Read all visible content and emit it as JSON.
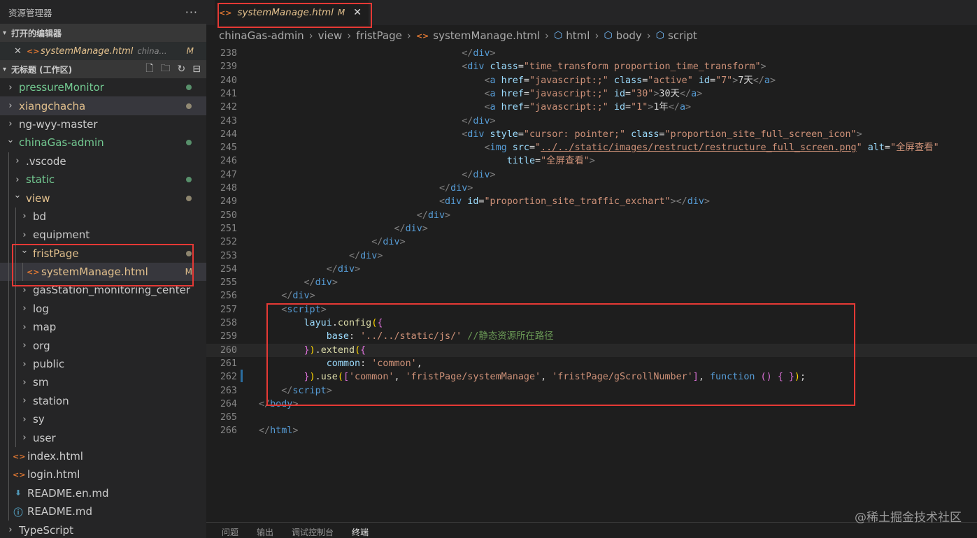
{
  "explorer": {
    "title": "资源管理器",
    "more": "···",
    "open_editors": {
      "title": "打开的编辑器",
      "file": "systemManage.html",
      "path": "china...",
      "flag": "M"
    },
    "workspace": {
      "title": "无标题 (工作区)",
      "tools": [
        "new-file",
        "new-folder",
        "refresh",
        "collapse"
      ]
    },
    "tree": [
      {
        "label": "pressureMonitor",
        "chev": ">",
        "indent": 0,
        "color": "green",
        "dot": "green",
        "bg": ""
      },
      {
        "label": "xiangchacha",
        "chev": ">",
        "indent": 0,
        "color": "yellow",
        "dot": "tan",
        "bg": "sel"
      },
      {
        "label": "ng-wyy-master",
        "chev": ">",
        "indent": 0,
        "color": "white",
        "dot": "",
        "bg": ""
      },
      {
        "label": "chinaGas-admin",
        "chev": "v",
        "indent": 0,
        "color": "green",
        "dot": "green",
        "bg": ""
      },
      {
        "label": ".vscode",
        "chev": ">",
        "indent": 1,
        "color": "white",
        "dot": "",
        "bg": ""
      },
      {
        "label": "static",
        "chev": ">",
        "indent": 1,
        "color": "green",
        "dot": "green",
        "bg": ""
      },
      {
        "label": "view",
        "chev": "v",
        "indent": 1,
        "color": "yellow",
        "dot": "tan",
        "bg": ""
      },
      {
        "label": "bd",
        "chev": ">",
        "indent": 2,
        "color": "white",
        "dot": "",
        "bg": ""
      },
      {
        "label": "equipment",
        "chev": ">",
        "indent": 2,
        "color": "white",
        "dot": "",
        "bg": ""
      },
      {
        "label": "fristPage",
        "chev": "v",
        "indent": 2,
        "color": "yellow",
        "dot": "tan",
        "bg": ""
      },
      {
        "label": "systemManage.html",
        "chev": "",
        "icon": "html",
        "indent": 3,
        "color": "yellow",
        "flag": "M",
        "bg": "sel"
      },
      {
        "label": "gasStation_monitoring_center",
        "chev": ">",
        "indent": 2,
        "color": "white",
        "dot": "",
        "bg": ""
      },
      {
        "label": "log",
        "chev": ">",
        "indent": 2,
        "color": "white",
        "dot": "",
        "bg": ""
      },
      {
        "label": "map",
        "chev": ">",
        "indent": 2,
        "color": "white",
        "dot": "",
        "bg": ""
      },
      {
        "label": "org",
        "chev": ">",
        "indent": 2,
        "color": "white",
        "dot": "",
        "bg": ""
      },
      {
        "label": "public",
        "chev": ">",
        "indent": 2,
        "color": "white",
        "dot": "",
        "bg": ""
      },
      {
        "label": "sm",
        "chev": ">",
        "indent": 2,
        "color": "white",
        "dot": "",
        "bg": ""
      },
      {
        "label": "station",
        "chev": ">",
        "indent": 2,
        "color": "white",
        "dot": "",
        "bg": ""
      },
      {
        "label": "sy",
        "chev": ">",
        "indent": 2,
        "color": "white",
        "dot": "",
        "bg": ""
      },
      {
        "label": "user",
        "chev": ">",
        "indent": 2,
        "color": "white",
        "dot": "",
        "bg": ""
      },
      {
        "label": "index.html",
        "chev": "",
        "icon": "html",
        "indent": 1,
        "color": "white",
        "dot": "",
        "bg": ""
      },
      {
        "label": "login.html",
        "chev": "",
        "icon": "html",
        "indent": 1,
        "color": "white",
        "dot": "",
        "bg": ""
      },
      {
        "label": "README.en.md",
        "chev": "",
        "icon": "md-dl",
        "indent": 1,
        "color": "white",
        "dot": "",
        "bg": ""
      },
      {
        "label": "README.md",
        "chev": "",
        "icon": "info",
        "indent": 1,
        "color": "white",
        "dot": "",
        "bg": ""
      },
      {
        "label": "TypeScript",
        "chev": ">",
        "indent": 0,
        "color": "white",
        "dot": "",
        "bg": ""
      }
    ]
  },
  "tab": {
    "name": "systemManage.html",
    "flag": "M",
    "close": "✕"
  },
  "breadcrumb": [
    "chinaGas-admin",
    "view",
    "fristPage",
    "systemManage.html",
    "html",
    "body",
    "script"
  ],
  "code_lines": [
    {
      "n": "238",
      "segs": [
        [
          "                                    ",
          "tx"
        ],
        [
          "</",
          "pu"
        ],
        [
          "div",
          "tg"
        ],
        [
          ">",
          "pu"
        ]
      ]
    },
    {
      "n": "239",
      "segs": [
        [
          "                                    ",
          "tx"
        ],
        [
          "<",
          "pu"
        ],
        [
          "div",
          "tg"
        ],
        [
          " class",
          "at"
        ],
        [
          "=",
          "tx"
        ],
        [
          "\"time_transform proportion_time_transform\"",
          "sv"
        ],
        [
          ">",
          "pu"
        ]
      ]
    },
    {
      "n": "240",
      "segs": [
        [
          "                                        ",
          "tx"
        ],
        [
          "<",
          "pu"
        ],
        [
          "a",
          "tg"
        ],
        [
          " href",
          "at"
        ],
        [
          "=",
          "tx"
        ],
        [
          "\"javascript:;\"",
          "sv"
        ],
        [
          " class",
          "at"
        ],
        [
          "=",
          "tx"
        ],
        [
          "\"active\"",
          "sv"
        ],
        [
          " id",
          "at"
        ],
        [
          "=",
          "tx"
        ],
        [
          "\"7\"",
          "sv"
        ],
        [
          ">",
          "pu"
        ],
        [
          "7天",
          "tx"
        ],
        [
          "</",
          "pu"
        ],
        [
          "a",
          "tg"
        ],
        [
          ">",
          "pu"
        ]
      ]
    },
    {
      "n": "241",
      "segs": [
        [
          "                                        ",
          "tx"
        ],
        [
          "<",
          "pu"
        ],
        [
          "a",
          "tg"
        ],
        [
          " href",
          "at"
        ],
        [
          "=",
          "tx"
        ],
        [
          "\"javascript:;\"",
          "sv"
        ],
        [
          " id",
          "at"
        ],
        [
          "=",
          "tx"
        ],
        [
          "\"30\"",
          "sv"
        ],
        [
          ">",
          "pu"
        ],
        [
          "30天",
          "tx"
        ],
        [
          "</",
          "pu"
        ],
        [
          "a",
          "tg"
        ],
        [
          ">",
          "pu"
        ]
      ]
    },
    {
      "n": "242",
      "segs": [
        [
          "                                        ",
          "tx"
        ],
        [
          "<",
          "pu"
        ],
        [
          "a",
          "tg"
        ],
        [
          " href",
          "at"
        ],
        [
          "=",
          "tx"
        ],
        [
          "\"javascript:;\"",
          "sv"
        ],
        [
          " id",
          "at"
        ],
        [
          "=",
          "tx"
        ],
        [
          "\"1\"",
          "sv"
        ],
        [
          ">",
          "pu"
        ],
        [
          "1年",
          "tx"
        ],
        [
          "</",
          "pu"
        ],
        [
          "a",
          "tg"
        ],
        [
          ">",
          "pu"
        ]
      ]
    },
    {
      "n": "243",
      "segs": [
        [
          "                                    ",
          "tx"
        ],
        [
          "</",
          "pu"
        ],
        [
          "div",
          "tg"
        ],
        [
          ">",
          "pu"
        ]
      ]
    },
    {
      "n": "244",
      "segs": [
        [
          "                                    ",
          "tx"
        ],
        [
          "<",
          "pu"
        ],
        [
          "div",
          "tg"
        ],
        [
          " style",
          "at"
        ],
        [
          "=",
          "tx"
        ],
        [
          "\"cursor: pointer;\"",
          "sv"
        ],
        [
          " class",
          "at"
        ],
        [
          "=",
          "tx"
        ],
        [
          "\"proportion_site_full_screen_icon\"",
          "sv"
        ],
        [
          ">",
          "pu"
        ]
      ]
    },
    {
      "n": "245",
      "segs": [
        [
          "                                        ",
          "tx"
        ],
        [
          "<",
          "pu"
        ],
        [
          "img",
          "tg"
        ],
        [
          " src",
          "at"
        ],
        [
          "=",
          "tx"
        ],
        [
          "\"",
          "sv"
        ],
        [
          "../../static/images/restruct/restructure_full_screen.png",
          "sv und"
        ],
        [
          "\"",
          "sv"
        ],
        [
          " alt",
          "at"
        ],
        [
          "=",
          "tx"
        ],
        [
          "\"全屏查看\"",
          "sv"
        ]
      ]
    },
    {
      "n": "246",
      "segs": [
        [
          "                                            ",
          "tx"
        ],
        [
          "title",
          "at"
        ],
        [
          "=",
          "tx"
        ],
        [
          "\"全屏查看\"",
          "sv"
        ],
        [
          ">",
          "pu"
        ]
      ]
    },
    {
      "n": "247",
      "segs": [
        [
          "                                    ",
          "tx"
        ],
        [
          "</",
          "pu"
        ],
        [
          "div",
          "tg"
        ],
        [
          ">",
          "pu"
        ]
      ]
    },
    {
      "n": "248",
      "segs": [
        [
          "                                ",
          "tx"
        ],
        [
          "</",
          "pu"
        ],
        [
          "div",
          "tg"
        ],
        [
          ">",
          "pu"
        ]
      ]
    },
    {
      "n": "249",
      "segs": [
        [
          "                                ",
          "tx"
        ],
        [
          "<",
          "pu"
        ],
        [
          "div",
          "tg"
        ],
        [
          " id",
          "at"
        ],
        [
          "=",
          "tx"
        ],
        [
          "\"proportion_site_traffic_exchart\"",
          "sv"
        ],
        [
          "></",
          "pu"
        ],
        [
          "div",
          "tg"
        ],
        [
          ">",
          "pu"
        ]
      ]
    },
    {
      "n": "250",
      "segs": [
        [
          "                            ",
          "tx"
        ],
        [
          "</",
          "pu"
        ],
        [
          "div",
          "tg"
        ],
        [
          ">",
          "pu"
        ]
      ]
    },
    {
      "n": "251",
      "segs": [
        [
          "                        ",
          "tx"
        ],
        [
          "</",
          "pu"
        ],
        [
          "div",
          "tg"
        ],
        [
          ">",
          "pu"
        ]
      ]
    },
    {
      "n": "252",
      "segs": [
        [
          "                    ",
          "tx"
        ],
        [
          "</",
          "pu"
        ],
        [
          "div",
          "tg"
        ],
        [
          ">",
          "pu"
        ]
      ]
    },
    {
      "n": "253",
      "segs": [
        [
          "                ",
          "tx"
        ],
        [
          "</",
          "pu"
        ],
        [
          "div",
          "tg"
        ],
        [
          ">",
          "pu"
        ]
      ]
    },
    {
      "n": "254",
      "segs": [
        [
          "            ",
          "tx"
        ],
        [
          "</",
          "pu"
        ],
        [
          "div",
          "tg"
        ],
        [
          ">",
          "pu"
        ]
      ]
    },
    {
      "n": "255",
      "segs": [
        [
          "        ",
          "tx"
        ],
        [
          "</",
          "pu"
        ],
        [
          "div",
          "tg"
        ],
        [
          ">",
          "pu"
        ]
      ]
    },
    {
      "n": "256",
      "segs": [
        [
          "    ",
          "tx"
        ],
        [
          "</",
          "pu"
        ],
        [
          "div",
          "tg"
        ],
        [
          ">",
          "pu"
        ]
      ]
    },
    {
      "n": "257",
      "segs": [
        [
          "    ",
          "tx"
        ],
        [
          "<",
          "pu"
        ],
        [
          "script",
          "tg"
        ],
        [
          ">",
          "pu"
        ]
      ]
    },
    {
      "n": "258",
      "segs": [
        [
          "        ",
          "tx"
        ],
        [
          "layui",
          "pr"
        ],
        [
          ".",
          "tx"
        ],
        [
          "config",
          "fn2"
        ],
        [
          "(",
          "b1"
        ],
        [
          "{",
          "b2"
        ]
      ]
    },
    {
      "n": "259",
      "segs": [
        [
          "            ",
          "tx"
        ],
        [
          "base",
          "pr"
        ],
        [
          ": ",
          "tx"
        ],
        [
          "'../../static/js/'",
          "sv"
        ],
        [
          " //静态资源所在路径",
          "cm"
        ]
      ]
    },
    {
      "n": "260",
      "segs": [
        [
          "        ",
          "tx"
        ],
        [
          "}",
          "b2"
        ],
        [
          ")",
          "b1"
        ],
        [
          ".",
          "tx"
        ],
        [
          "extend",
          "fn2"
        ],
        [
          "(",
          "b1"
        ],
        [
          "{",
          "b2"
        ]
      ],
      "hl": true
    },
    {
      "n": "261",
      "segs": [
        [
          "            ",
          "tx"
        ],
        [
          "common",
          "pr"
        ],
        [
          ": ",
          "tx"
        ],
        [
          "'common'",
          "sv"
        ],
        [
          ",",
          "tx"
        ]
      ]
    },
    {
      "n": "262",
      "segs": [
        [
          "        ",
          "tx"
        ],
        [
          "}",
          "b2"
        ],
        [
          ")",
          "b1"
        ],
        [
          ".",
          "tx"
        ],
        [
          "use",
          "fn2"
        ],
        [
          "(",
          "b1"
        ],
        [
          "[",
          "b2"
        ],
        [
          "'common'",
          "sv"
        ],
        [
          ", ",
          "tx"
        ],
        [
          "'fristPage/systemManage'",
          "sv"
        ],
        [
          ", ",
          "tx"
        ],
        [
          "'fristPage/gScrollNumber'",
          "sv"
        ],
        [
          "]",
          "b2"
        ],
        [
          ", ",
          "tx"
        ],
        [
          "function",
          "kw"
        ],
        [
          " ",
          "tx"
        ],
        [
          "()",
          "b2"
        ],
        [
          " ",
          "tx"
        ],
        [
          "{",
          "b2"
        ],
        [
          " ",
          "tx"
        ],
        [
          "}",
          "b2"
        ],
        [
          ")",
          "b1"
        ],
        [
          ";",
          "tx"
        ]
      ]
    },
    {
      "n": "263",
      "segs": [
        [
          "    ",
          "tx"
        ],
        [
          "</",
          "pu"
        ],
        [
          "script",
          "tg"
        ],
        [
          ">",
          "pu"
        ]
      ]
    },
    {
      "n": "264",
      "segs": [
        [
          "</",
          "pu"
        ],
        [
          "body",
          "tg"
        ],
        [
          ">",
          "pu"
        ]
      ]
    },
    {
      "n": "265",
      "segs": []
    },
    {
      "n": "266",
      "segs": [
        [
          "</",
          "pu"
        ],
        [
          "html",
          "tg"
        ],
        [
          ">",
          "pu"
        ]
      ]
    }
  ],
  "panel_tabs": [
    "问题",
    "输出",
    "调试控制台",
    "终端"
  ],
  "watermark": "@稀土掘金技术社区"
}
